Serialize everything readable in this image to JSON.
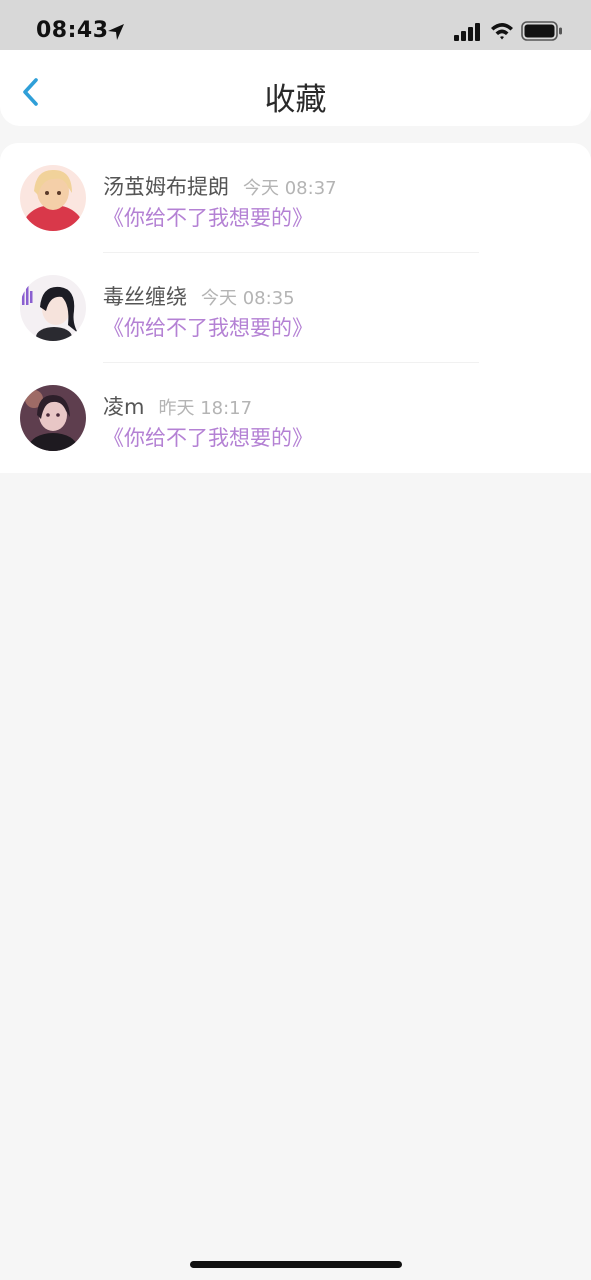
{
  "status_bar": {
    "time": "08:43"
  },
  "header": {
    "title": "收藏"
  },
  "favorites": [
    {
      "name": "汤茧姆布提朗",
      "time": "今天 08:37",
      "title": "《你给不了我想要的》",
      "avatar_color": "#d9384a"
    },
    {
      "name": "毒丝缠绕",
      "time": "今天 08:35",
      "title": "《你给不了我想要的》",
      "avatar_color": "#efe9ec"
    },
    {
      "name": "凌m",
      "time": "昨天 18:17",
      "title": "《你给不了我想要的》",
      "avatar_color": "#6e4a5c"
    }
  ],
  "colors": {
    "accent": "#2f9fd8",
    "title_purple": "#b481d4",
    "status_bar_bg": "#d8d8d8",
    "page_bg": "#f6f6f6"
  }
}
